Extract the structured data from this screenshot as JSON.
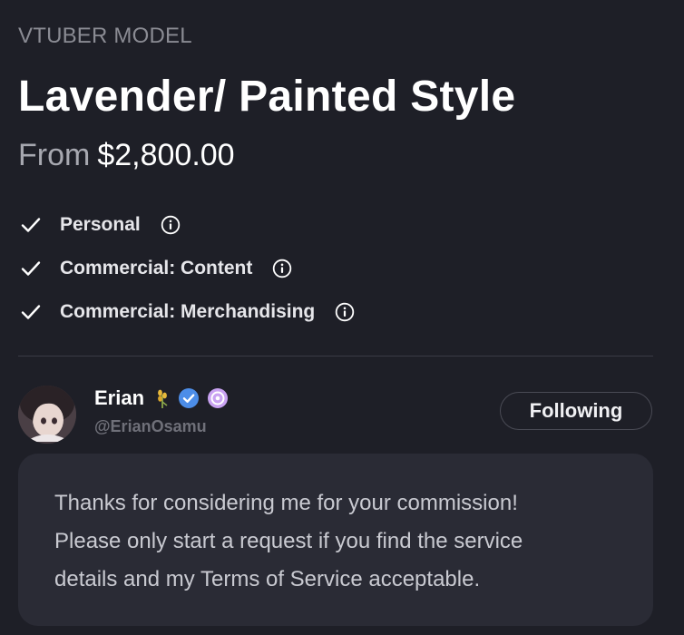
{
  "listing": {
    "category": "VTUBER MODEL",
    "title": "Lavender/ Painted Style",
    "price_prefix": "From",
    "price": "$2,800.00"
  },
  "licenses": [
    {
      "label": "Personal",
      "check_icon": "check-icon",
      "info_icon": "info-icon"
    },
    {
      "label": "Commercial: Content",
      "check_icon": "check-icon",
      "info_icon": "info-icon"
    },
    {
      "label": "Commercial: Merchandising",
      "check_icon": "check-icon",
      "info_icon": "info-icon"
    }
  ],
  "artist": {
    "name": "Erian",
    "handle": "@ErianOsamu",
    "badges": [
      "wheat-emoji-icon",
      "verified-check-icon",
      "purple-coin-icon"
    ],
    "follow_label": "Following"
  },
  "message": {
    "lines": [
      "Thanks for considering me for your commission!",
      "Please only start a request if you find the service",
      "details and my Terms of Service acceptable."
    ]
  },
  "colors": {
    "background": "#1e1f27",
    "card": "#2a2b35",
    "muted_text": "#8a8b93",
    "verified_blue": "#4c8de8",
    "coin_purple": "#c9a2f2"
  }
}
